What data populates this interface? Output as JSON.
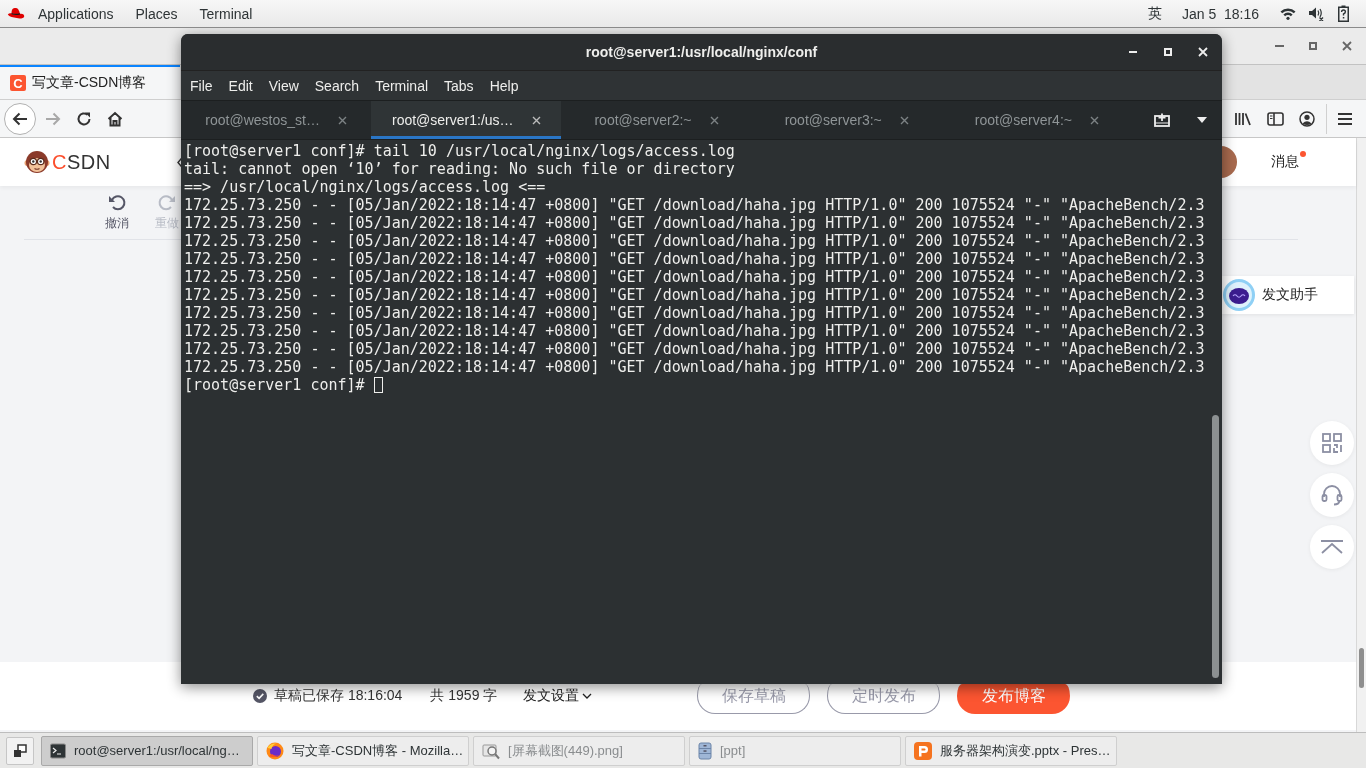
{
  "top_bar": {
    "menus": [
      "Applications",
      "Places",
      "Terminal"
    ],
    "input_method": "英",
    "clock": "Jan 5  18:16"
  },
  "browser": {
    "tabs": [
      {
        "favicon": "C",
        "title": "写文章-CSDN博客",
        "selected": true
      }
    ],
    "navigation": {
      "back": {
        "disabled": false
      },
      "forward": {
        "disabled": true
      }
    },
    "page": {
      "logo": "CSDN",
      "messages": {
        "label": "消息",
        "unread": true
      },
      "editor_toolbar": [
        {
          "kind": "undo",
          "label": "撤消",
          "disabled": false
        },
        {
          "kind": "redo",
          "label": "重做",
          "disabled": true
        }
      ],
      "assistant": "发文助手",
      "footer": {
        "saved": "草稿已保存 18:16:04",
        "word_count": "共 1959 字",
        "settings": "发文设置",
        "buttons": [
          {
            "label": "保存草稿",
            "kind": "outline"
          },
          {
            "label": "定时发布",
            "kind": "outline"
          },
          {
            "label": "发布博客",
            "kind": "primary"
          }
        ]
      }
    }
  },
  "terminal": {
    "title": "root@server1:/usr/local/nginx/conf",
    "menu": [
      "File",
      "Edit",
      "View",
      "Search",
      "Terminal",
      "Tabs",
      "Help"
    ],
    "tabs": [
      {
        "label": "root@westos_st…",
        "selected": false
      },
      {
        "label": "root@server1:/us…",
        "selected": true
      },
      {
        "label": "root@server2:~",
        "selected": false
      },
      {
        "label": "root@server3:~",
        "selected": false
      },
      {
        "label": "root@server4:~",
        "selected": false
      }
    ],
    "lines": [
      "[root@server1 conf]# tail 10 /usr/local/nginx/logs/access.log",
      "tail: cannot open ‘10’ for reading: No such file or directory",
      "==> /usr/local/nginx/logs/access.log <==",
      "172.25.73.250 - - [05/Jan/2022:18:14:47 +0800] \"GET /download/haha.jpg HTTP/1.0\" 200 1075524 \"-\" \"ApacheBench/2.3",
      "172.25.73.250 - - [05/Jan/2022:18:14:47 +0800] \"GET /download/haha.jpg HTTP/1.0\" 200 1075524 \"-\" \"ApacheBench/2.3",
      "172.25.73.250 - - [05/Jan/2022:18:14:47 +0800] \"GET /download/haha.jpg HTTP/1.0\" 200 1075524 \"-\" \"ApacheBench/2.3",
      "172.25.73.250 - - [05/Jan/2022:18:14:47 +0800] \"GET /download/haha.jpg HTTP/1.0\" 200 1075524 \"-\" \"ApacheBench/2.3",
      "172.25.73.250 - - [05/Jan/2022:18:14:47 +0800] \"GET /download/haha.jpg HTTP/1.0\" 200 1075524 \"-\" \"ApacheBench/2.3",
      "172.25.73.250 - - [05/Jan/2022:18:14:47 +0800] \"GET /download/haha.jpg HTTP/1.0\" 200 1075524 \"-\" \"ApacheBench/2.3",
      "172.25.73.250 - - [05/Jan/2022:18:14:47 +0800] \"GET /download/haha.jpg HTTP/1.0\" 200 1075524 \"-\" \"ApacheBench/2.3",
      "172.25.73.250 - - [05/Jan/2022:18:14:47 +0800] \"GET /download/haha.jpg HTTP/1.0\" 200 1075524 \"-\" \"ApacheBench/2.3",
      "172.25.73.250 - - [05/Jan/2022:18:14:47 +0800] \"GET /download/haha.jpg HTTP/1.0\" 200 1075524 \"-\" \"ApacheBench/2.3",
      "172.25.73.250 - - [05/Jan/2022:18:14:47 +0800] \"GET /download/haha.jpg HTTP/1.0\" 200 1075524 \"-\" \"ApacheBench/2.3"
    ],
    "prompt": "[root@server1 conf]#"
  },
  "taskbar": {
    "items": [
      {
        "kind": "terminal",
        "label": "root@server1:/usr/local/ng…",
        "selected": true,
        "minimized": false
      },
      {
        "kind": "browser",
        "label": "写文章-CSDN博客 - Mozilla…",
        "selected": false,
        "minimized": false
      },
      {
        "kind": "image",
        "label": "[屏幕截图(449).png]",
        "selected": false,
        "minimized": true
      },
      {
        "kind": "files",
        "label": "[ppt]",
        "selected": false,
        "minimized": true
      },
      {
        "kind": "slides",
        "label": "服务器架构演变.pptx - Pres…",
        "selected": false,
        "minimized": false
      }
    ]
  }
}
